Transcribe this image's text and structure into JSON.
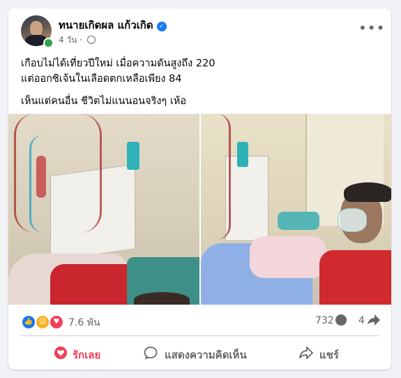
{
  "post": {
    "author": "ทนายเกิดผล แก้วเกิด",
    "time": "4 วัน",
    "time_separator": "·",
    "line1": "เกือบไม่ได้เที่ยวปีใหม่ เมื่อความดันสูงถึง 220",
    "line2": "แต่ออกซิเจ้นในเลือดตกเหลือเพียง 84",
    "line3": "เห็นแต่คนอื่น  ชีวิตไม่แนนอนจริงๆ เห้อ"
  },
  "stats": {
    "reactions": "7.6 พัน",
    "comments": "732",
    "shares": "4"
  },
  "actions": {
    "like": "รักเลย",
    "comment": "แสดงความคิดเห็น",
    "share": "แชร์"
  },
  "colors": {
    "like_blue": "#1877f2",
    "love_red": "#f33e58",
    "care_yellow": "#f7b125",
    "love_action": "#f33e58",
    "online_green": "#31a24c"
  },
  "icons": {
    "verified": "verified-badge-icon",
    "privacy": "globe-icon",
    "more": "more-horizontal-icon",
    "reaction_like": "like-reaction-icon",
    "reaction_care": "care-reaction-icon",
    "reaction_love": "love-reaction-icon",
    "comment": "comment-bubble-icon",
    "share": "share-arrow-icon"
  }
}
